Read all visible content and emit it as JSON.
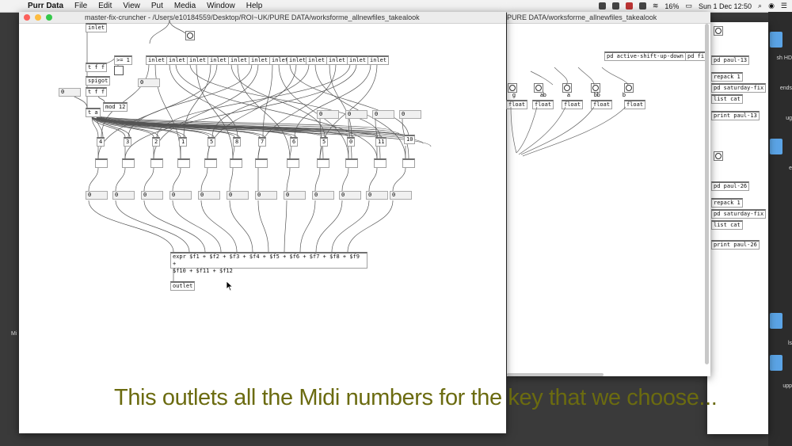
{
  "menubar": {
    "app_name": "Purr Data",
    "items": [
      "File",
      "Edit",
      "View",
      "Put",
      "Media",
      "Window",
      "Help"
    ],
    "battery": "16%",
    "clock": "Sun 1 Dec  12:50"
  },
  "main_window": {
    "title": "master-fix-cruncher  - /Users/e10184559/Desktop/ROI~UK/PURE DATA/worksforme_allnewfiles_takealook",
    "objects": {
      "inlet_top": "inlet",
      "msg_ge1": ">= 1",
      "t_f_f_1": "t f f",
      "spigot": "spigot",
      "t_f_f_2": "t f f",
      "t_a": "t a",
      "mod12": "mod 12",
      "zero_a": "0",
      "zero_b": "0",
      "inlets": [
        "inlet",
        "inlet",
        "inlet",
        "inlet",
        "inlet",
        "inlet",
        "inlet",
        "inlet",
        "inlet",
        "inlet",
        "inlet",
        "inlet"
      ],
      "expr_line1": "expr $f1 + $f2 + $f3 + $f4 + $f5 + $f6 + $f7 + $f8 + $f9 +",
      "expr_line2": "$f10 + $f11 + $f12",
      "outlet": "outlet",
      "select_labels": [
        "4",
        "3",
        "2",
        "1",
        "5",
        "8",
        "7",
        "6",
        "5",
        "0",
        "11",
        "10",
        "9"
      ],
      "row_zero_boxes": [
        "0",
        "0",
        "0",
        "0",
        "0",
        "0",
        "0",
        "0",
        "0",
        "0",
        "0",
        "0"
      ],
      "top_zero_boxes": [
        "0",
        "0",
        "0",
        "0"
      ]
    }
  },
  "back_window": {
    "title": "PURE DATA/worksforme_allnewfiles_takealook",
    "pd_active": "pd active-shift-up-down",
    "pd_fi": "pd fi",
    "bang_labels": [
      "g",
      "ab",
      "a",
      "bb",
      "b"
    ],
    "float_labels": [
      "float",
      "float",
      "float",
      "float",
      "float"
    ]
  },
  "side_window": {
    "items": [
      "pd paul-13",
      "repack 1",
      "pd saturday-fix",
      "list cat",
      "print paul-13",
      "pd paul-26",
      "repack 1",
      "pd saturday-fix",
      "list cat",
      "print paul-26"
    ]
  },
  "desktop": {
    "labels": [
      "sh HD",
      "ends",
      "ug",
      "e",
      "ls",
      "upp"
    ],
    "left_label": "Mi"
  },
  "caption": "This outlets all the Midi numbers for the key that we choose..."
}
